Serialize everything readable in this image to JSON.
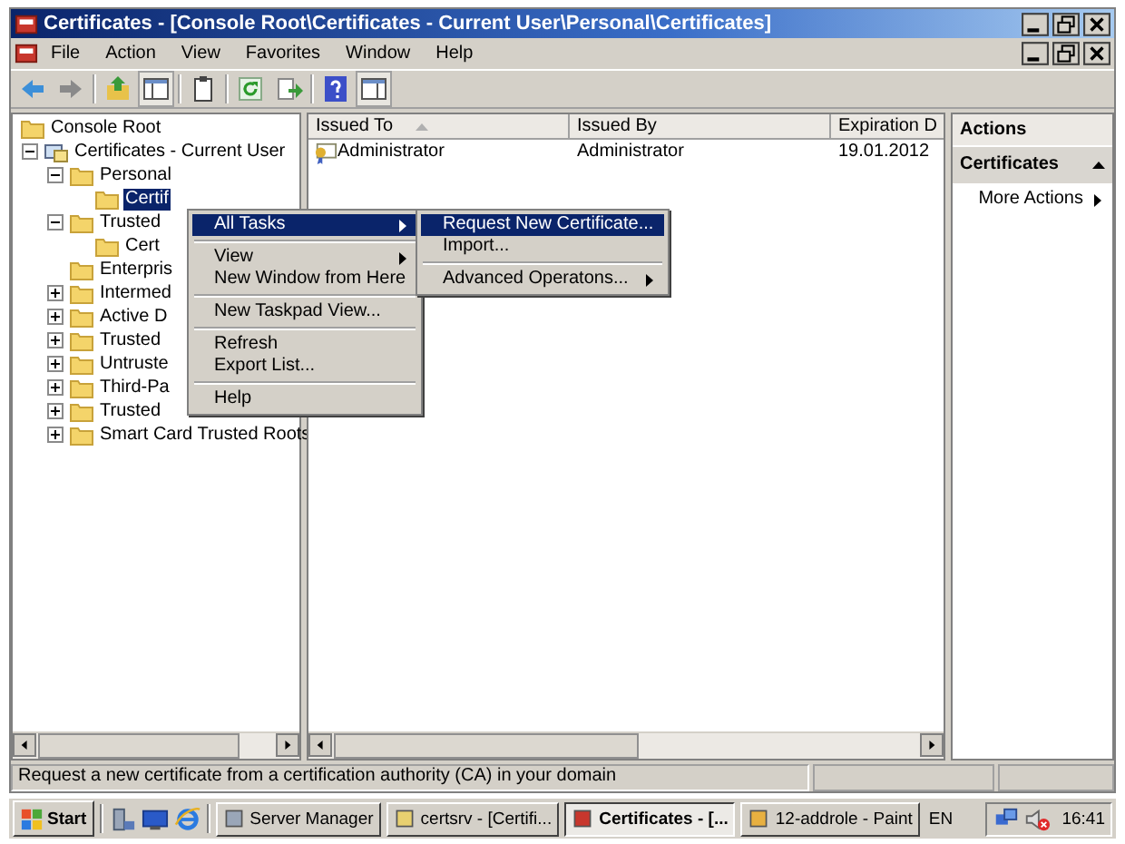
{
  "window": {
    "title": "Certificates - [Console Root\\Certificates - Current User\\Personal\\Certificates]"
  },
  "menu_bar": [
    "File",
    "Action",
    "View",
    "Favorites",
    "Window",
    "Help"
  ],
  "tree": [
    {
      "label": "Console Root",
      "kind": "folder",
      "selected": false,
      "children": [
        {
          "label": "Certificates - Current User",
          "kind": "store",
          "selected": false,
          "expanded": true,
          "children": [
            {
              "label": "Personal",
              "kind": "folder",
              "selected": false,
              "expanded": true,
              "children": [
                {
                  "label": "Certif",
                  "kind": "folder",
                  "selected": true
                }
              ]
            },
            {
              "label": "Trusted",
              "kind": "folder",
              "selected": false,
              "expanded": true,
              "children": [
                {
                  "label": "Cert",
                  "kind": "folder",
                  "selected": false
                }
              ]
            },
            {
              "label": "Enterpris",
              "kind": "folder",
              "selected": false
            },
            {
              "label": "Intermed",
              "kind": "folder",
              "selected": false,
              "expanded": false
            },
            {
              "label": "Active D",
              "kind": "folder",
              "selected": false,
              "expanded": false
            },
            {
              "label": "Trusted",
              "kind": "folder",
              "selected": false,
              "expanded": false
            },
            {
              "label": "Untruste",
              "kind": "folder",
              "selected": false,
              "expanded": false
            },
            {
              "label": "Third-Pa",
              "kind": "folder",
              "selected": false,
              "expanded": false
            },
            {
              "label": "Trusted",
              "kind": "folder",
              "selected": false,
              "expanded": false
            },
            {
              "label": "Smart Card Trusted Roots",
              "kind": "folder",
              "selected": false,
              "expanded": false
            }
          ]
        }
      ]
    }
  ],
  "table": {
    "columns": [
      "Issued To",
      "Issued By",
      "Expiration D"
    ],
    "rows": [
      [
        "Administrator",
        "Administrator",
        "19.01.2012"
      ]
    ]
  },
  "actions": {
    "title": "Actions",
    "section": "Certificates",
    "items": [
      "More Actions"
    ]
  },
  "context_menu": [
    {
      "kind": "item",
      "label": "All Tasks",
      "selected": true,
      "submenu": true
    },
    {
      "kind": "separator"
    },
    {
      "kind": "item",
      "label": "View",
      "selected": false,
      "submenu": true
    },
    {
      "kind": "item",
      "label": "New Window from Here",
      "selected": false,
      "submenu": false
    },
    {
      "kind": "separator"
    },
    {
      "kind": "item",
      "label": "New Taskpad View...",
      "selected": false,
      "submenu": false
    },
    {
      "kind": "separator"
    },
    {
      "kind": "item",
      "label": "Refresh",
      "selected": false,
      "submenu": false
    },
    {
      "kind": "item",
      "label": "Export List...",
      "selected": false,
      "submenu": false
    },
    {
      "kind": "separator"
    },
    {
      "kind": "item",
      "label": "Help",
      "selected": false,
      "submenu": false
    }
  ],
  "submenu": [
    {
      "kind": "item",
      "label": "Request New Certificate...",
      "selected": true,
      "submenu": false
    },
    {
      "kind": "item",
      "label": "Import...",
      "selected": false,
      "submenu": false
    },
    {
      "kind": "separator"
    },
    {
      "kind": "item",
      "label": "Advanced Operatons...",
      "selected": false,
      "submenu": true
    }
  ],
  "status_bar": "Request a new certificate from a certification authority (CA) in your domain",
  "taskbar": {
    "start": "Start",
    "tasks": [
      {
        "label": "Server Manager",
        "selected": false
      },
      {
        "label": "certsrv - [Certifi...",
        "selected": false
      },
      {
        "label": "Certificates - [...",
        "selected": true
      },
      {
        "label": "12-addrole - Paint",
        "selected": false
      }
    ],
    "language": "EN",
    "clock": "16:41"
  }
}
